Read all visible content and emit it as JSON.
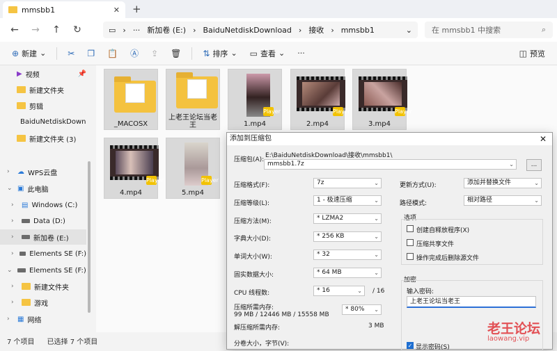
{
  "tab": {
    "title": "mmsbb1",
    "close": "✕",
    "new": "+"
  },
  "nav": {
    "back": "←",
    "forward": "→",
    "up": "↑",
    "refresh": "↻"
  },
  "breadcrumb": [
    "新加卷 (E:)",
    "BaiduNetdiskDownload",
    "接收",
    "mmsbb1"
  ],
  "breadcrumb_more": "···",
  "search": {
    "placeholder": "在 mmsbb1 中搜索"
  },
  "toolbar": {
    "new": "新建",
    "sort": "排序",
    "view": "查看",
    "more": "···",
    "preview": "预览"
  },
  "sidebar": [
    {
      "label": "视频"
    },
    {
      "label": "新建文件夹"
    },
    {
      "label": "剪辑"
    },
    {
      "label": "BaiduNetdiskDownl"
    },
    {
      "label": "新建文件夹 (3)"
    },
    {
      "label": "WPS云盘"
    },
    {
      "label": "此电脑"
    },
    {
      "label": "Windows (C:)"
    },
    {
      "label": "Data (D:)"
    },
    {
      "label": "新加卷 (E:)"
    },
    {
      "label": "Elements SE (F:)"
    },
    {
      "label": "Elements SE (F:)"
    },
    {
      "label": "新建文件夹"
    },
    {
      "label": "游戏"
    },
    {
      "label": "网络"
    }
  ],
  "files": [
    {
      "name": "_MACOSX",
      "kind": "folder"
    },
    {
      "name": "上老王论坛当老王",
      "kind": "folder"
    },
    {
      "name": "1.mp4",
      "kind": "video"
    },
    {
      "name": "2.mp4",
      "kind": "video"
    },
    {
      "name": "3.mp4",
      "kind": "video"
    },
    {
      "name": "4.mp4",
      "kind": "video"
    },
    {
      "name": "5.mp4",
      "kind": "video"
    }
  ],
  "badge": "Player",
  "status": {
    "count": "7 个项目",
    "selected": "已选择 7 个项目"
  },
  "dialog": {
    "title": "添加到压缩包",
    "close": "✕",
    "archive_label": "压缩包(A):",
    "archive_path": "E:\\BaiduNetdiskDownload\\接收\\mmsbb1\\",
    "archive_name": "mmsbb1.7z",
    "browse": "...",
    "format_label": "压缩格式(F):",
    "format": "7z",
    "level_label": "压缩等级(L):",
    "level": "1 - 极速压缩",
    "method_label": "压缩方法(M):",
    "method": "* LZMA2",
    "dict_label": "字典大小(D):",
    "dict": "* 256 KB",
    "word_label": "单词大小(W):",
    "word": "* 32",
    "solid_label": "固实数据大小:",
    "solid": "* 64 MB",
    "cpu_label": "CPU 线程数:",
    "cpu": "* 16",
    "cpu_total": "/ 16",
    "mem_label": "压缩所需内存:",
    "mem_values": "99 MB / 12446 MB / 15558 MB",
    "mem_pct": "* 80%",
    "decomp_label": "解压缩所需内存:",
    "decomp": "3 MB",
    "split_label": "分卷大小，字节(V):",
    "update_label": "更新方式(U):",
    "update": "添加并替换文件",
    "path_label": "路径模式:",
    "path": "相对路径",
    "options_title": "选项",
    "opt_sfx": "创建自释放程序(X)",
    "opt_shared": "压缩共享文件",
    "opt_delete": "操作完成后删除源文件",
    "enc_title": "加密",
    "pwd_label": "输入密码:",
    "pwd_value": "上老王论坛当老王",
    "show_pwd": "显示密码(S)"
  },
  "watermark": {
    "cn": "老王论坛",
    "en": "laowang.vip"
  }
}
